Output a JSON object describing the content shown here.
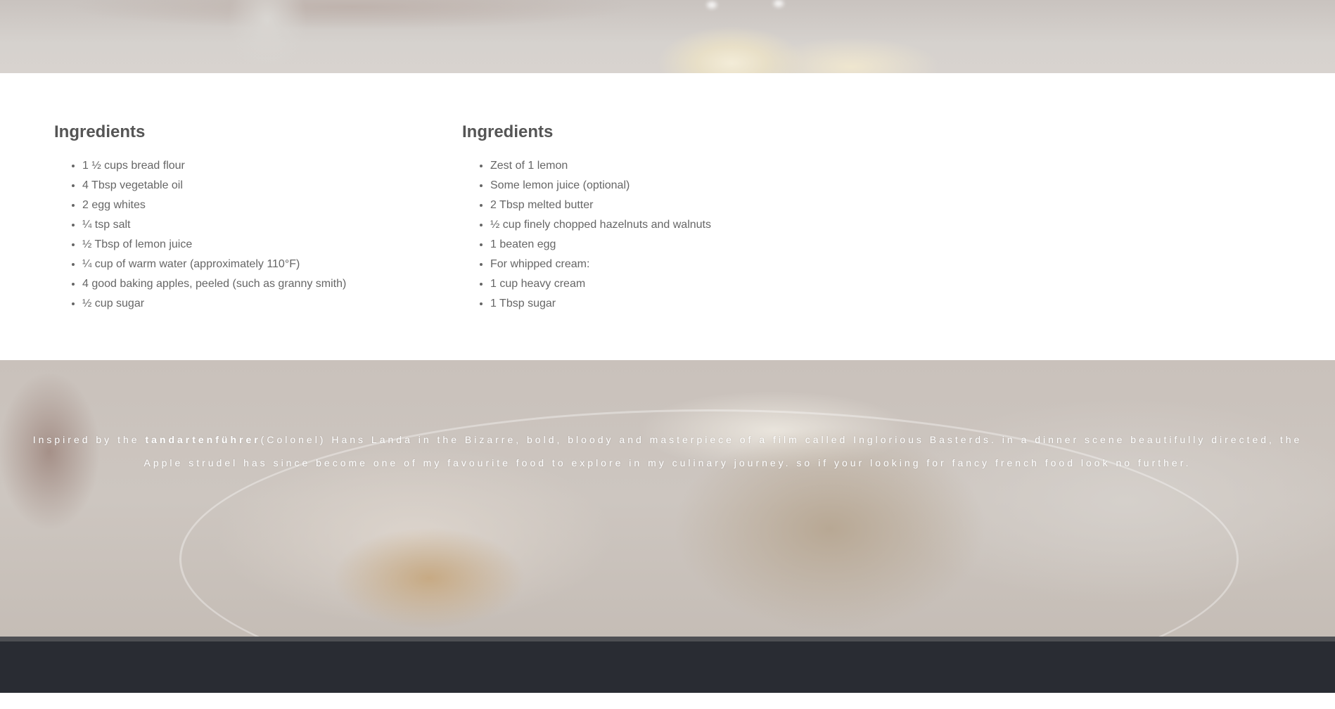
{
  "columns": [
    {
      "heading": "Ingredients",
      "items": [
        "1 ½ cups bread flour",
        "4 Tbsp vegetable oil",
        "2 egg whites",
        "¼ tsp salt",
        "½ Tbsp of lemon juice",
        "¼ cup of warm water (approximately 110°F)",
        "4 good baking apples, peeled (such as granny smith)",
        "½ cup sugar"
      ]
    },
    {
      "heading": "Ingredients",
      "items": [
        "Zest of 1 lemon",
        "Some lemon juice (optional)",
        "2 Tbsp melted butter",
        "½ cup finely chopped hazelnuts and walnuts",
        "1 beaten egg",
        "For whipped cream:",
        "1 cup heavy cream",
        "1 Tbsp sugar"
      ]
    }
  ],
  "tagline": {
    "prefix": "Inspired by the ",
    "emphasis": "tandartenführer",
    "suffix": "(Colonel) Hans Landa in the Bizarre, bold, bloody and masterpiece of a film called Inglorious Basterds. in a dinner scene beautifully directed, the Apple strudel has since become one of my favourite food to explore in my culinary journey. so if your looking for fancy french food look no further."
  },
  "colors": {
    "heading": "#555555",
    "list_text": "#666666",
    "footer": "#292c33",
    "divider": "#4d4f53",
    "tagline": "#ffffff"
  }
}
